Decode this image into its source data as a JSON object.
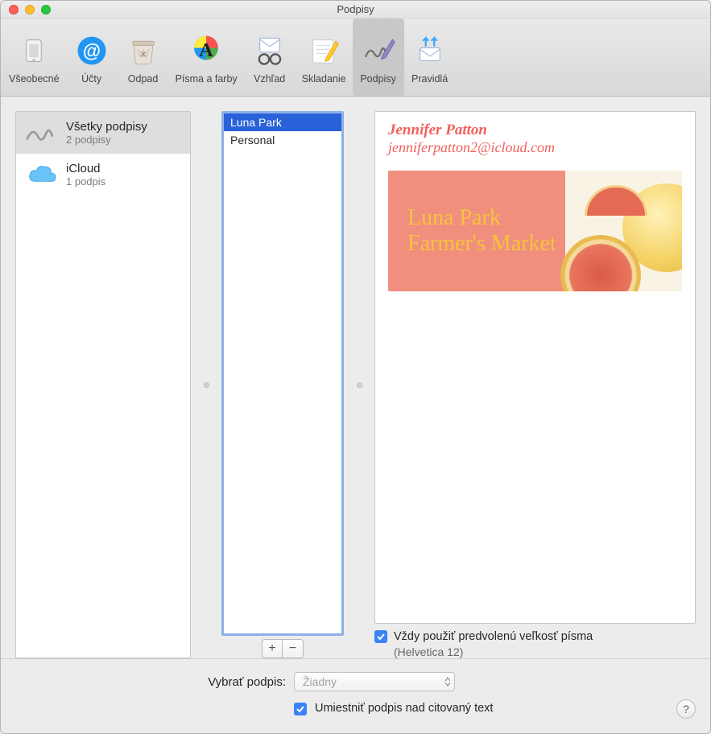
{
  "window": {
    "title": "Podpisy"
  },
  "toolbar": {
    "items": [
      {
        "label": "Všeobecné",
        "name": "general"
      },
      {
        "label": "Účty",
        "name": "accounts"
      },
      {
        "label": "Odpad",
        "name": "junk"
      },
      {
        "label": "Písma a farby",
        "name": "fonts-colors"
      },
      {
        "label": "Vzhľad",
        "name": "viewing"
      },
      {
        "label": "Skladanie",
        "name": "composing"
      },
      {
        "label": "Podpisy",
        "name": "signatures",
        "active": true
      },
      {
        "label": "Pravidlá",
        "name": "rules"
      }
    ]
  },
  "accounts": [
    {
      "title": "Všetky podpisy",
      "subtitle": "2 podpisy",
      "selected": true,
      "icon": "signature"
    },
    {
      "title": "iCloud",
      "subtitle": "1 podpis",
      "selected": false,
      "icon": "cloud"
    }
  ],
  "signature_list": [
    {
      "name": "Luna Park",
      "selected": true
    },
    {
      "name": "Personal",
      "selected": false
    }
  ],
  "preview": {
    "name": "Jennifer Patton",
    "email": "jenniferpatton2@icloud.com",
    "banner_line1": "Luna Park",
    "banner_line2": "Farmer's Market"
  },
  "options": {
    "default_font_label": "Vždy použiť predvolenú veľkosť písma",
    "default_font_sub": "(Helvetica 12)",
    "default_font_checked": true,
    "choose_label": "Vybrať podpis:",
    "choose_value": "Žiadny",
    "place_above_label": "Umiestniť podpis nad citovaný text",
    "place_above_checked": true
  },
  "buttons": {
    "add": "+",
    "remove": "−",
    "help": "?"
  },
  "colors": {
    "accent_blue": "#3b82f6",
    "selection_blue": "#2961d9",
    "salmon": "#f25f5c",
    "banner_bg": "#f08f7e",
    "banner_text": "#f7c33c"
  }
}
